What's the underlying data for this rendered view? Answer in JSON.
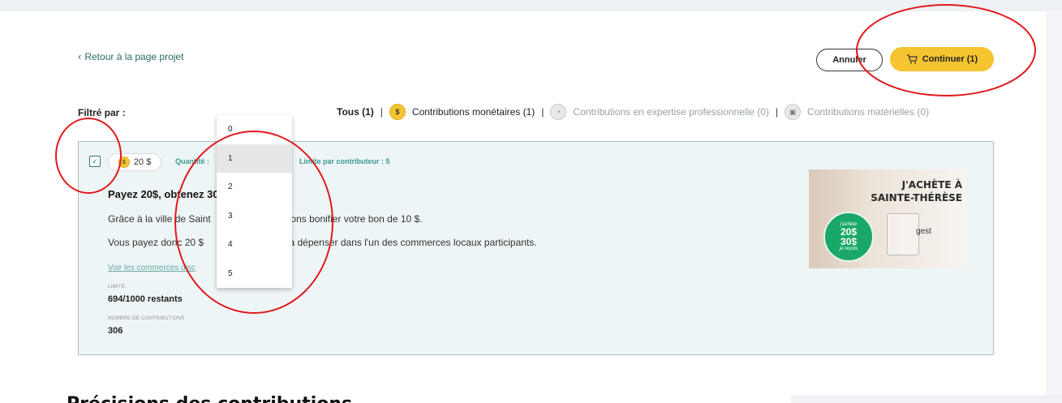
{
  "nav": {
    "back_label": "Retour à la page projet"
  },
  "actions": {
    "cancel_label": "Annuler",
    "continue_label": "Continuer (1)"
  },
  "filters": {
    "label": "Filtré par :",
    "all": "Tous (1)",
    "monetary": "Contributions monétaires (1)",
    "expertise": "Contributions en expertise professionnelle (0)",
    "material": "Contributions matérielles (0)",
    "separator": "|"
  },
  "card": {
    "price": "20 $",
    "quantity_label": "Quantité :",
    "limit_per_contributor": "Limite par contributeur : 5",
    "title": "Payez 20$, obtenez 30",
    "desc_1_a": "Grâce à la ville de Saint",
    "desc_1_b": "allons bonifier votre bon de 10 $.",
    "desc_2_a": "Vous payez donc 20 $",
    "desc_2_b": "30 $ à dépenser dans l'un des commerces locaux participants.",
    "partners_link": "Voir les commerces disc",
    "limit_label": "LIMITE",
    "limit_value": "694/1000 restants",
    "contrib_label": "NOMBRE DE CONTRIBUTIONS",
    "contrib_value": "306"
  },
  "promo": {
    "headline_1": "J'ACHÈTE À",
    "headline_2": "SAINTE-THÉRÈSE",
    "top_small": "j'achète",
    "value_1": "20$",
    "value_2": "30$",
    "bottom_small": "je reçois",
    "brand": "gest"
  },
  "quantity_dropdown": {
    "options": [
      "0",
      "1",
      "2",
      "3",
      "4",
      "5"
    ],
    "selected": "1"
  },
  "section": {
    "heading": "Précisions des contributions"
  },
  "colors": {
    "accent_yellow": "#f6c431",
    "teal": "#2b7a70",
    "annotation_red": "#e0191b",
    "card_bg": "#eef5f7"
  }
}
